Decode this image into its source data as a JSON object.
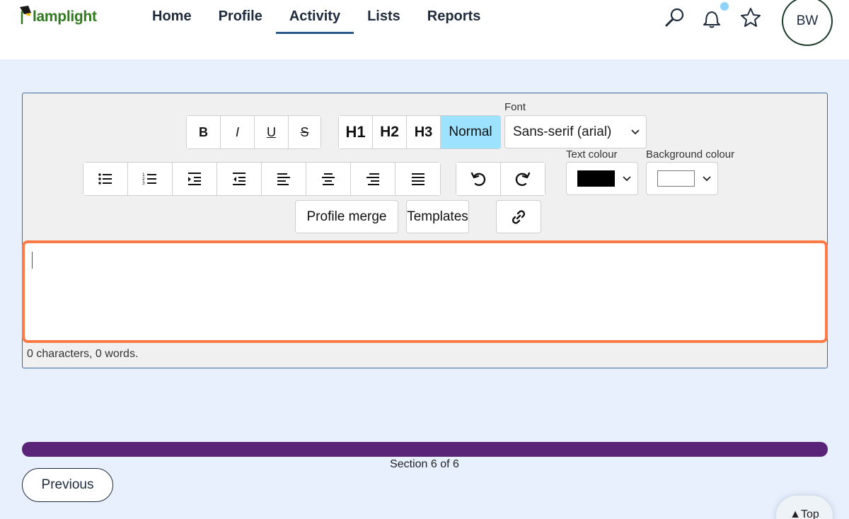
{
  "app": {
    "logo_text": "lamplight"
  },
  "nav": {
    "items": [
      {
        "label": "Home"
      },
      {
        "label": "Profile"
      },
      {
        "label": "Activity",
        "active": true
      },
      {
        "label": "Lists"
      },
      {
        "label": "Reports"
      }
    ]
  },
  "header": {
    "icons": [
      "search-icon",
      "bell-icon",
      "star-icon"
    ],
    "avatar_initials": "BW",
    "notification_dot_color": "#8fd4ff"
  },
  "toolbar": {
    "format_buttons": [
      {
        "label": "B",
        "name": "bold"
      },
      {
        "label": "I",
        "name": "italic"
      },
      {
        "label": "U",
        "name": "underline"
      },
      {
        "label": "S",
        "name": "strikethrough"
      }
    ],
    "heading_buttons": [
      {
        "label": "H1"
      },
      {
        "label": "H2"
      },
      {
        "label": "H3"
      },
      {
        "label": "Normal",
        "selected": true
      }
    ],
    "font_label": "Font",
    "font_value": "Sans-serif (arial)",
    "text_colour_label": "Text colour",
    "text_colour_value": "#000000",
    "background_colour_label": "Background colour",
    "background_colour_value": "#ffffff",
    "list_align_icons": [
      "bullet-list-icon",
      "numbered-list-icon",
      "indent-icon",
      "outdent-icon",
      "align-left-icon",
      "align-center-icon",
      "align-right-icon",
      "justify-icon"
    ],
    "history_icons": [
      "undo-icon",
      "redo-icon"
    ],
    "profile_merge_label": "Profile merge",
    "templates_label": "Templates",
    "link_icon": "link-icon"
  },
  "editor": {
    "value": "",
    "counter": "0 characters, 0 words.",
    "focus_color": "#ff7a45"
  },
  "progress": {
    "value": 1.0,
    "fill_color": "#5a2579",
    "section_text": "Section 6 of 6"
  },
  "footer": {
    "previous_label": "Previous",
    "top_label": "▲Top"
  }
}
